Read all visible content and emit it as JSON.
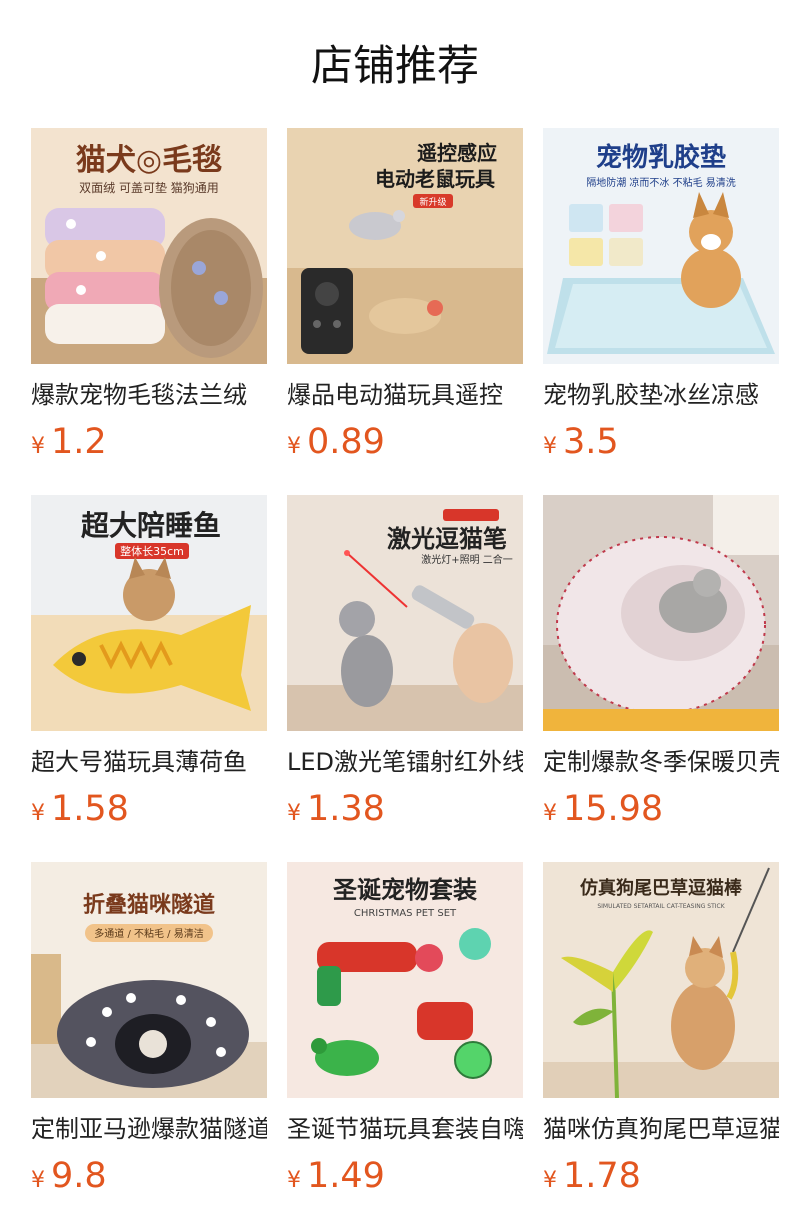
{
  "section": {
    "title": "店铺推荐"
  },
  "currency_symbol": "¥",
  "products": [
    {
      "name": "爆款宠物毛毯法兰绒",
      "price": "1.2",
      "banner": "猫犬◎毛毯",
      "sub": "双面绒 可盖可垫 猫狗通用",
      "bg": "#f3e3cf",
      "accent": "#7a3a1c"
    },
    {
      "name": "爆品电动猫玩具遥控",
      "price": "0.89",
      "banner": "遥控感应",
      "banner2": "电动老鼠玩具",
      "sub": "新升级",
      "bg": "#e9d3b1",
      "accent": "#1c1c1c"
    },
    {
      "name": "宠物乳胶垫冰丝凉感",
      "price": "3.5",
      "banner": "宠物乳胶垫",
      "sub": "隔地防潮 凉而不冰 不粘毛 易清洗",
      "bg": "#eef3f7",
      "accent": "#1f3f8a"
    },
    {
      "name": "超大号猫玩具薄荷鱼",
      "price": "1.58",
      "banner": "超大陪睡鱼",
      "sub": "整体长35cm",
      "bg": "#eef0f2",
      "accent": "#222222"
    },
    {
      "name": "LED激光笔镭射红外线",
      "price": "1.38",
      "banner": "激光逗猫笔",
      "sub": "激光灯+照明 二合一",
      "bg": "#ece2d8",
      "accent": "#222222"
    },
    {
      "name": "定制爆款冬季保暖贝壳",
      "price": "15.98",
      "banner": "",
      "sub": "",
      "bg": "#d9cfc7",
      "accent": "#c0384a"
    },
    {
      "name": "定制亚马逊爆款猫隧道",
      "price": "9.8",
      "banner": "折叠猫咪隧道",
      "sub": "多通道 / 不粘毛 / 易清洁",
      "bg": "#f4ede3",
      "accent": "#7a3a1c"
    },
    {
      "name": "圣诞节猫玩具套装自嗨",
      "price": "1.49",
      "banner": "圣诞宠物套装",
      "sub": "CHRISTMAS PET SET",
      "bg": "#f6e8e1",
      "accent": "#222222"
    },
    {
      "name": "猫咪仿真狗尾巴草逗猫",
      "price": "1.78",
      "banner": "仿真狗尾巴草逗猫棒",
      "sub": "SIMULATED SETARTAIL CAT-TEASING STICK",
      "bg": "#efe4d6",
      "accent": "#3a2a1a"
    }
  ]
}
